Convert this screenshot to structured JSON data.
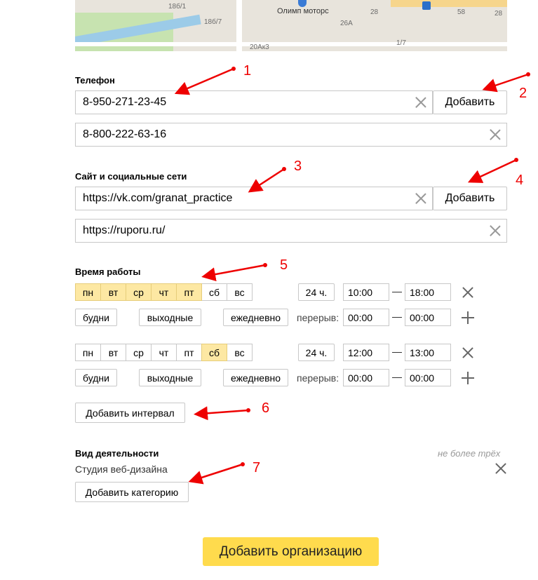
{
  "map": {
    "labels": [
      "18б/1",
      "18б/7",
      "Олимп моторс",
      "28",
      "26А",
      "20Ак3",
      "1/7",
      "58",
      "28"
    ]
  },
  "phone": {
    "title": "Телефон",
    "items": [
      {
        "value": "8-950-271-23-45"
      },
      {
        "value": "8-800-222-63-16"
      }
    ],
    "add_label": "Добавить"
  },
  "sites": {
    "title": "Сайт и социальные сети",
    "items": [
      {
        "value": "https://vk.com/granat_practice"
      },
      {
        "value": "https://ruporu.ru/"
      }
    ],
    "add_label": "Добавить"
  },
  "hours": {
    "title": "Время работы",
    "days": [
      "пн",
      "вт",
      "ср",
      "чт",
      "пт",
      "сб",
      "вс"
    ],
    "intervals": [
      {
        "selected_days": [
          "пн",
          "вт",
          "ср",
          "чт",
          "пт"
        ],
        "all_day_label": "24 ч.",
        "from": "10:00",
        "to": "18:00",
        "preset_weekdays": "будни",
        "preset_weekend": "выходные",
        "preset_daily": "ежедневно",
        "break_label": "перерыв:",
        "break_from": "00:00",
        "break_to": "00:00"
      },
      {
        "selected_days": [
          "сб"
        ],
        "all_day_label": "24 ч.",
        "from": "12:00",
        "to": "13:00",
        "preset_weekdays": "будни",
        "preset_weekend": "выходные",
        "preset_daily": "ежедневно",
        "break_label": "перерыв:",
        "break_from": "00:00",
        "break_to": "00:00"
      }
    ],
    "add_interval_label": "Добавить интервал"
  },
  "activity": {
    "title": "Вид деятельности",
    "hint": "не более трёх",
    "category": "Студия веб-дизайна",
    "add_category_label": "Добавить категорию"
  },
  "submit_label": "Добавить организацию",
  "annotations": [
    "1",
    "2",
    "3",
    "4",
    "5",
    "6",
    "7"
  ],
  "colors": {
    "accent_button": "#ffdb4d",
    "selected_day": "#fde8a3",
    "annotation": "#e00000"
  }
}
